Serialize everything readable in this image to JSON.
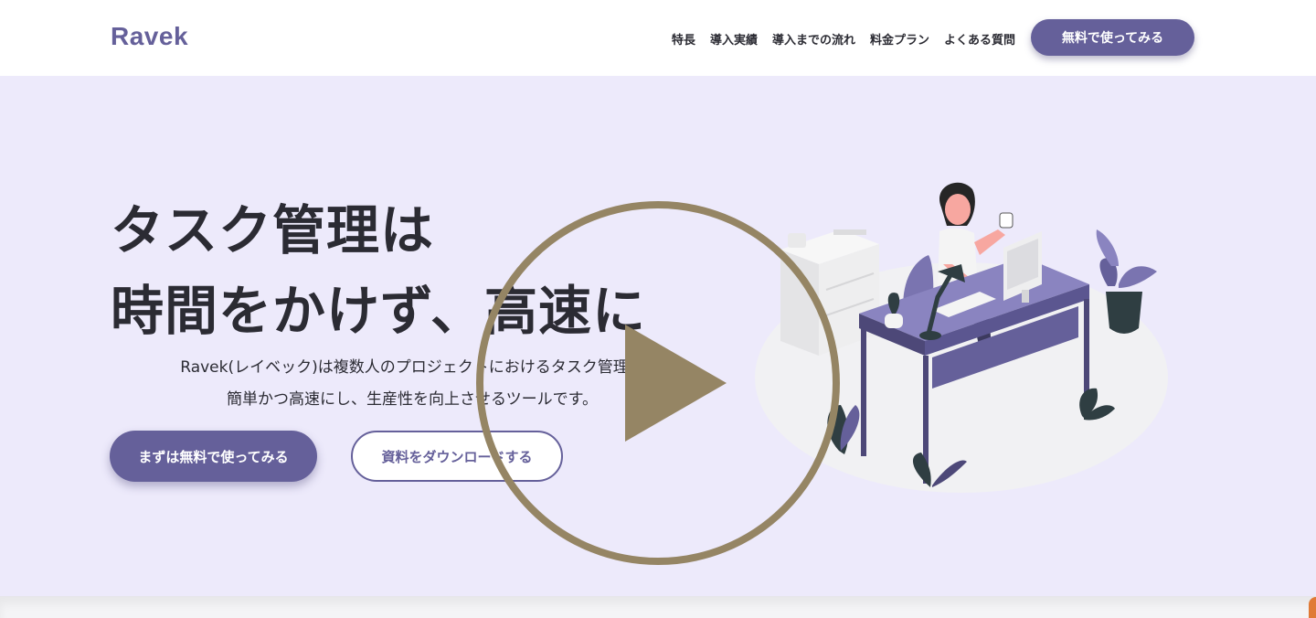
{
  "header": {
    "logo": "Ravek",
    "nav": [
      "特長",
      "導入実績",
      "導入までの流れ",
      "料金プラン",
      "よくある質問"
    ],
    "cta": "無料で使ってみる"
  },
  "hero": {
    "title_line1": "タスク管理は",
    "title_line2": "時間をかけず、高速に",
    "description_line1": "Ravek(レイベック)は複数人のプロジェクトにおけるタスク管理を",
    "description_line2": "簡単かつ高速にし、生産性を向上させるツールです。",
    "primary_button": "まずは無料で使ってみる",
    "secondary_button": "資料をダウンロードする"
  },
  "colors": {
    "brand": "#65609a",
    "hero_bg": "#edeafb",
    "play_overlay": "#958564"
  },
  "icons": {
    "play_overlay": "play-icon"
  }
}
